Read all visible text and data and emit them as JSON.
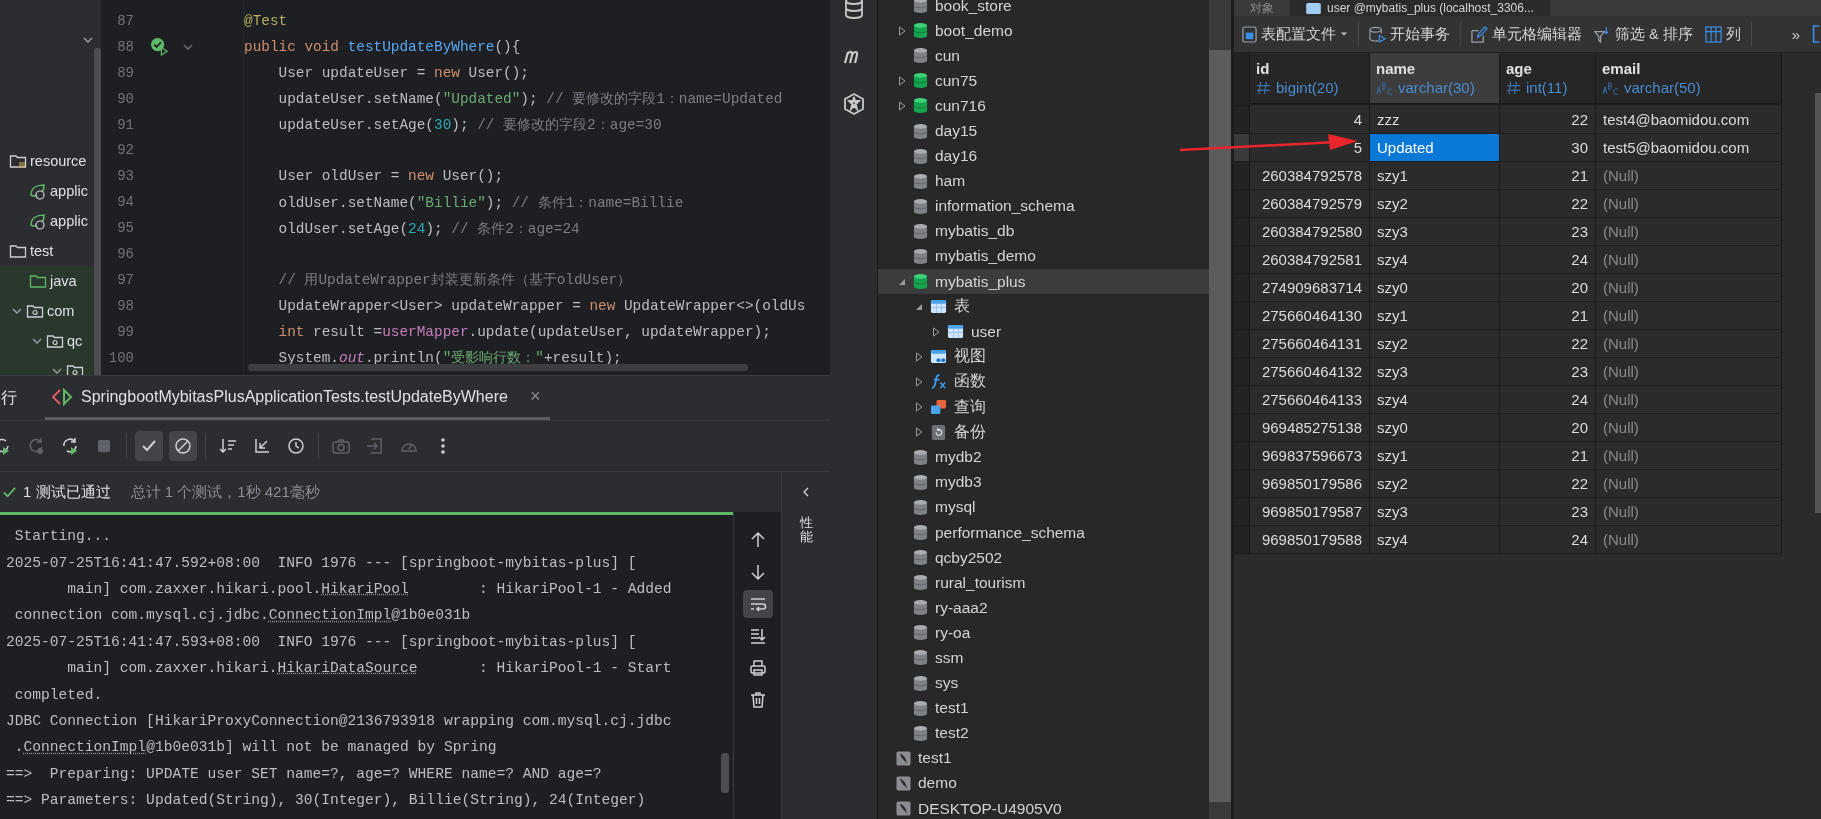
{
  "project_tree": {
    "items": [
      {
        "label": "resource",
        "kind": "resources",
        "children": [
          {
            "label": "applic",
            "kind": "config"
          },
          {
            "label": "applic",
            "kind": "config"
          }
        ]
      },
      {
        "label": "test",
        "kind": "folder",
        "children": [
          {
            "label": "java",
            "kind": "source"
          },
          {
            "label": "com",
            "kind": "package",
            "expanded": true,
            "children": [
              {
                "label": "qc",
                "kind": "package",
                "expanded": true,
                "children": [
                  {
                    "kind": "package",
                    "expanded": true
                  }
                ]
              }
            ]
          }
        ]
      }
    ]
  },
  "editor": {
    "lines": [
      {
        "number": "87",
        "run_marker": false,
        "tokens": [
          {
            "text": "@Test",
            "kind": "ann"
          }
        ]
      },
      {
        "number": "88",
        "run_marker": true,
        "tokens": [
          {
            "text": "public void ",
            "kind": "kw"
          },
          {
            "text": "testUpdateByWhere",
            "kind": "fn"
          },
          {
            "text": "(){",
            "kind": "plain"
          }
        ]
      },
      {
        "number": "89",
        "run_marker": false,
        "tokens": [
          {
            "text": "    User updateUser = ",
            "kind": "plain"
          },
          {
            "text": "new ",
            "kind": "kw"
          },
          {
            "text": "User();",
            "kind": "plain"
          }
        ]
      },
      {
        "number": "90",
        "run_marker": false,
        "tokens": [
          {
            "text": "    updateUser.setName(",
            "kind": "plain"
          },
          {
            "text": "\"Updated\"",
            "kind": "str"
          },
          {
            "text": "); ",
            "kind": "plain"
          },
          {
            "text": "// 要修改的字段1：name=Updated",
            "kind": "com"
          }
        ]
      },
      {
        "number": "91",
        "run_marker": false,
        "tokens": [
          {
            "text": "    updateUser.setAge(",
            "kind": "plain"
          },
          {
            "text": "30",
            "kind": "num"
          },
          {
            "text": "); ",
            "kind": "plain"
          },
          {
            "text": "// 要修改的字段2：age=30",
            "kind": "com"
          }
        ]
      },
      {
        "number": "92",
        "run_marker": false
      },
      {
        "number": "93",
        "run_marker": false,
        "tokens": [
          {
            "text": "    User oldUser = ",
            "kind": "plain"
          },
          {
            "text": "new ",
            "kind": "kw"
          },
          {
            "text": "User();",
            "kind": "plain"
          }
        ]
      },
      {
        "number": "94",
        "run_marker": false,
        "tokens": [
          {
            "text": "    oldUser.setName(",
            "kind": "plain"
          },
          {
            "text": "\"Billie\"",
            "kind": "str"
          },
          {
            "text": "); ",
            "kind": "plain"
          },
          {
            "text": "// 条件1：name=Billie",
            "kind": "com"
          }
        ]
      },
      {
        "number": "95",
        "run_marker": false,
        "tokens": [
          {
            "text": "    oldUser.setAge(",
            "kind": "plain"
          },
          {
            "text": "24",
            "kind": "num"
          },
          {
            "text": "); ",
            "kind": "plain"
          },
          {
            "text": "// 条件2：age=24",
            "kind": "com"
          }
        ]
      },
      {
        "number": "96",
        "run_marker": false
      },
      {
        "number": "97",
        "run_marker": false,
        "tokens": [
          {
            "text": "    // 用UpdateWrapper封装更新条件（基于oldUser）",
            "kind": "com"
          }
        ]
      },
      {
        "number": "98",
        "run_marker": false,
        "tokens": [
          {
            "text": "    UpdateWrapper<User> updateWrapper = ",
            "kind": "plain"
          },
          {
            "text": "new ",
            "kind": "kw"
          },
          {
            "text": "UpdateWrapper<>(oldUs",
            "kind": "plain"
          }
        ]
      },
      {
        "number": "99",
        "run_marker": false,
        "tokens": [
          {
            "text": "    int ",
            "kind": "kw"
          },
          {
            "text": "result =",
            "kind": "plain"
          },
          {
            "text": "userMapper",
            "kind": "field"
          },
          {
            "text": ".update(updateUser, updateWrapper);",
            "kind": "plain"
          }
        ]
      },
      {
        "number": "100",
        "run_marker": false,
        "tokens": [
          {
            "text": "    System.",
            "kind": "plain"
          },
          {
            "text": "out",
            "kind": "static"
          },
          {
            "text": ".println(",
            "kind": "plain"
          },
          {
            "text": "\"受影响行数：\"",
            "kind": "str"
          },
          {
            "text": "+result);",
            "kind": "plain"
          }
        ]
      }
    ]
  },
  "run_panel": {
    "title": "行",
    "tab": {
      "label": "SpringbootMybitasPlusApplicationTests.testUpdateByWhere",
      "close": "×",
      "selected": true
    },
    "toolbar": [
      {
        "kind": "rerun",
        "disabled": false,
        "selected": false
      },
      {
        "kind": "rerun-failed",
        "disabled": true,
        "selected": false
      },
      {
        "kind": "auto-rerun",
        "disabled": false,
        "selected": false
      },
      {
        "kind": "stop",
        "disabled": true,
        "selected": false
      },
      {
        "kind": "show-passed",
        "disabled": false,
        "selected": true
      },
      {
        "kind": "show-ignored",
        "disabled": false,
        "selected": true
      },
      {
        "kind": "sort",
        "disabled": false,
        "selected": false
      },
      {
        "kind": "collapse",
        "disabled": false,
        "selected": false
      },
      {
        "kind": "history",
        "disabled": false,
        "selected": false
      },
      {
        "kind": "screenshot",
        "disabled": true,
        "selected": false
      },
      {
        "kind": "export",
        "disabled": true,
        "selected": false
      },
      {
        "kind": "coverage",
        "disabled": true,
        "selected": false
      },
      {
        "kind": "more",
        "disabled": false,
        "selected": false
      }
    ],
    "status": {
      "passed": "1 测试已通过",
      "summary": "总计 1 个测试，1秒 421毫秒"
    },
    "console": {
      "lines": [
        [
          {
            "text": " Starting..."
          }
        ],
        [
          {
            "text": "2025-07-25T16:41:47.592+08:00  INFO 1976 --- [springboot-mybitas-plus] ["
          }
        ],
        [
          {
            "text": "       main] com.zaxxer.hikari.pool."
          },
          {
            "text": "HikariPool",
            "kind": "link"
          },
          {
            "text": "        : HikariPool-1 - Added"
          }
        ],
        [
          {
            "text": " connection com.mysql.cj.jdbc."
          },
          {
            "text": "ConnectionImpl",
            "kind": "link"
          },
          {
            "text": "@1b0e031b"
          }
        ],
        [
          {
            "text": "2025-07-25T16:41:47.593+08:00  INFO 1976 --- [springboot-mybitas-plus] ["
          }
        ],
        [
          {
            "text": "       main] com.zaxxer.hikari."
          },
          {
            "text": "HikariDataSource",
            "kind": "link"
          },
          {
            "text": "       : HikariPool-1 - Start"
          }
        ],
        [
          {
            "text": " completed."
          }
        ],
        [
          {
            "text": "JDBC Connection [HikariProxyConnection@2136793918 wrapping com.mysql.cj.jdbc"
          }
        ],
        [
          {
            "text": " ."
          },
          {
            "text": "ConnectionImpl",
            "kind": "link"
          },
          {
            "text": "@1b0e031b] will not be managed by Spring"
          }
        ],
        [
          {
            "text": "==>  Preparing: UPDATE user SET name=?, age=? WHERE name=? AND age=?"
          }
        ],
        [
          {
            "text": "==> Parameters: Updated(String), 30(Integer), Billie(String), 24(Integer)"
          }
        ]
      ]
    },
    "side_tools": [
      {
        "kind": "up",
        "selected": false
      },
      {
        "kind": "down",
        "selected": false
      },
      {
        "kind": "wrap",
        "selected": true
      },
      {
        "kind": "scroll-end",
        "selected": false
      },
      {
        "kind": "print",
        "selected": false
      },
      {
        "kind": "delete",
        "selected": false
      }
    ],
    "side_tab": "性能"
  },
  "db_sidebar": [
    {
      "kind": "database"
    },
    {
      "kind": "m"
    },
    {
      "kind": "logo"
    }
  ],
  "db_tree": {
    "databases": [
      {
        "name": "book_store",
        "open": false,
        "selected": false
      },
      {
        "name": "boot_demo",
        "open": true,
        "selected": false,
        "expanded": false
      },
      {
        "name": "cun",
        "open": false,
        "selected": false
      },
      {
        "name": "cun75",
        "open": true,
        "selected": false,
        "expanded": false
      },
      {
        "name": "cun716",
        "open": true,
        "selected": false,
        "expanded": false
      },
      {
        "name": "day15",
        "open": false,
        "selected": false
      },
      {
        "name": "day16",
        "open": false,
        "selected": false
      },
      {
        "name": "ham",
        "open": false,
        "selected": false
      },
      {
        "name": "information_schema",
        "open": false,
        "selected": false
      },
      {
        "name": "mybatis_db",
        "open": false,
        "selected": false
      },
      {
        "name": "mybatis_demo",
        "open": false,
        "selected": false
      },
      {
        "name": "mybatis_plus",
        "open": true,
        "selected": true,
        "expanded": true,
        "children": [
          {
            "name": "表",
            "kind": "tables",
            "expanded": true,
            "children": [
              {
                "name": "user",
                "kind": "table",
                "expanded": false
              }
            ]
          },
          {
            "name": "视图",
            "kind": "views",
            "expanded": false
          },
          {
            "name": "函数",
            "kind": "functions",
            "expanded": false
          },
          {
            "name": "查询",
            "kind": "queries",
            "expanded": false
          },
          {
            "name": "备份",
            "kind": "backups",
            "expanded": false
          }
        ]
      },
      {
        "name": "mydb2",
        "open": false,
        "selected": false
      },
      {
        "name": "mydb3",
        "open": false,
        "selected": false
      },
      {
        "name": "mysql",
        "open": false,
        "selected": false
      },
      {
        "name": "performance_schema",
        "open": false,
        "selected": false
      },
      {
        "name": "qcby2502",
        "open": false,
        "selected": false
      },
      {
        "name": "rural_tourism",
        "open": false,
        "selected": false
      },
      {
        "name": "ry-aaa2",
        "open": false,
        "selected": false
      },
      {
        "name": "ry-oa",
        "open": false,
        "selected": false
      },
      {
        "name": "ssm",
        "open": false,
        "selected": false
      },
      {
        "name": "sys",
        "open": false,
        "selected": false
      },
      {
        "name": "test1",
        "open": false,
        "selected": false
      },
      {
        "name": "test2",
        "open": false,
        "selected": false
      }
    ],
    "connections": [
      {
        "name": "test1"
      },
      {
        "name": "demo"
      },
      {
        "name": "DESKTOP-U4905V0"
      }
    ]
  },
  "data_view": {
    "tabs": [
      {
        "label": "对象",
        "selected": false
      },
      {
        "label": "user @mybatis_plus (localhost_3306...",
        "selected": true
      }
    ],
    "toolbar": [
      {
        "label": "表配置文件",
        "kind": "profile",
        "dropdown": true
      },
      {
        "label": "开始事务",
        "kind": "transaction",
        "dropdown": false
      },
      {
        "label": "单元格编辑器",
        "kind": "edit",
        "dropdown": false
      },
      {
        "label": "筛选 & 排序",
        "kind": "filter",
        "dropdown": false
      },
      {
        "label": "列",
        "kind": "columns",
        "dropdown": false
      }
    ],
    "overflow": "»",
    "columns": [
      {
        "name": "id",
        "type": "bigint(20)",
        "kind": "number",
        "selected": false
      },
      {
        "name": "name",
        "type": "varchar(30)",
        "kind": "text",
        "selected": true
      },
      {
        "name": "age",
        "type": "int(11)",
        "kind": "number",
        "selected": false
      },
      {
        "name": "email",
        "type": "varchar(50)",
        "kind": "text",
        "selected": false
      }
    ],
    "rows": [
      {
        "selected": false,
        "cells": [
          "4",
          "zzz",
          "22",
          "test4@baomidou.com"
        ]
      },
      {
        "selected": true,
        "cells": [
          "5",
          "Updated",
          "30",
          "test5@baomidou.com"
        ]
      },
      {
        "selected": false,
        "cells": [
          "260384792578",
          "szy1",
          "21",
          {
            "v": "(Null)",
            "null": true
          }
        ]
      },
      {
        "selected": false,
        "cells": [
          "260384792579",
          "szy2",
          "22",
          {
            "v": "(Null)",
            "null": true
          }
        ]
      },
      {
        "selected": false,
        "cells": [
          "260384792580",
          "szy3",
          "23",
          {
            "v": "(Null)",
            "null": true
          }
        ]
      },
      {
        "selected": false,
        "cells": [
          "260384792581",
          "szy4",
          "24",
          {
            "v": "(Null)",
            "null": true
          }
        ]
      },
      {
        "selected": false,
        "cells": [
          "274909683714",
          "szy0",
          "20",
          {
            "v": "(Null)",
            "null": true
          }
        ]
      },
      {
        "selected": false,
        "cells": [
          "275660464130",
          "szy1",
          "21",
          {
            "v": "(Null)",
            "null": true
          }
        ]
      },
      {
        "selected": false,
        "cells": [
          "275660464131",
          "szy2",
          "22",
          {
            "v": "(Null)",
            "null": true
          }
        ]
      },
      {
        "selected": false,
        "cells": [
          "275660464132",
          "szy3",
          "23",
          {
            "v": "(Null)",
            "null": true
          }
        ]
      },
      {
        "selected": false,
        "cells": [
          "275660464133",
          "szy4",
          "24",
          {
            "v": "(Null)",
            "null": true
          }
        ]
      },
      {
        "selected": false,
        "cells": [
          "969485275138",
          "szy0",
          "20",
          {
            "v": "(Null)",
            "null": true
          }
        ]
      },
      {
        "selected": false,
        "cells": [
          "969837596673",
          "szy1",
          "21",
          {
            "v": "(Null)",
            "null": true
          }
        ]
      },
      {
        "selected": false,
        "cells": [
          "969850179586",
          "szy2",
          "22",
          {
            "v": "(Null)",
            "null": true
          }
        ]
      },
      {
        "selected": false,
        "cells": [
          "969850179587",
          "szy3",
          "23",
          {
            "v": "(Null)",
            "null": true
          }
        ]
      },
      {
        "selected": false,
        "cells": [
          "969850179588",
          "szy4",
          "24",
          {
            "v": "(Null)",
            "null": true
          }
        ]
      }
    ]
  }
}
